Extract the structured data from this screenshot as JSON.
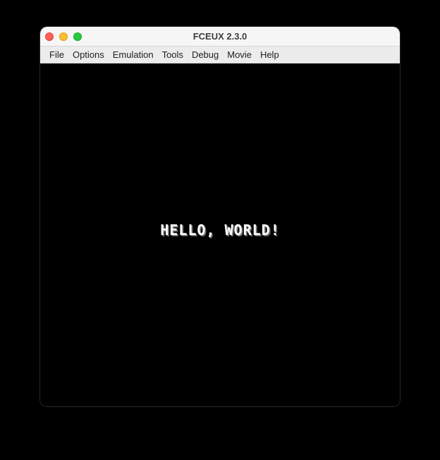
{
  "window": {
    "title": "FCEUX 2.3.0"
  },
  "menubar": {
    "items": [
      {
        "label": "File"
      },
      {
        "label": "Options"
      },
      {
        "label": "Emulation"
      },
      {
        "label": "Tools"
      },
      {
        "label": "Debug"
      },
      {
        "label": "Movie"
      },
      {
        "label": "Help"
      }
    ]
  },
  "screen": {
    "text": "HELLO, WORLD!"
  },
  "colors": {
    "screen_bg": "#000000",
    "close": "#fe5f57",
    "minimize": "#febc2e",
    "maximize": "#28c840"
  },
  "icons": [
    "close-icon",
    "minimize-icon",
    "maximize-icon"
  ]
}
